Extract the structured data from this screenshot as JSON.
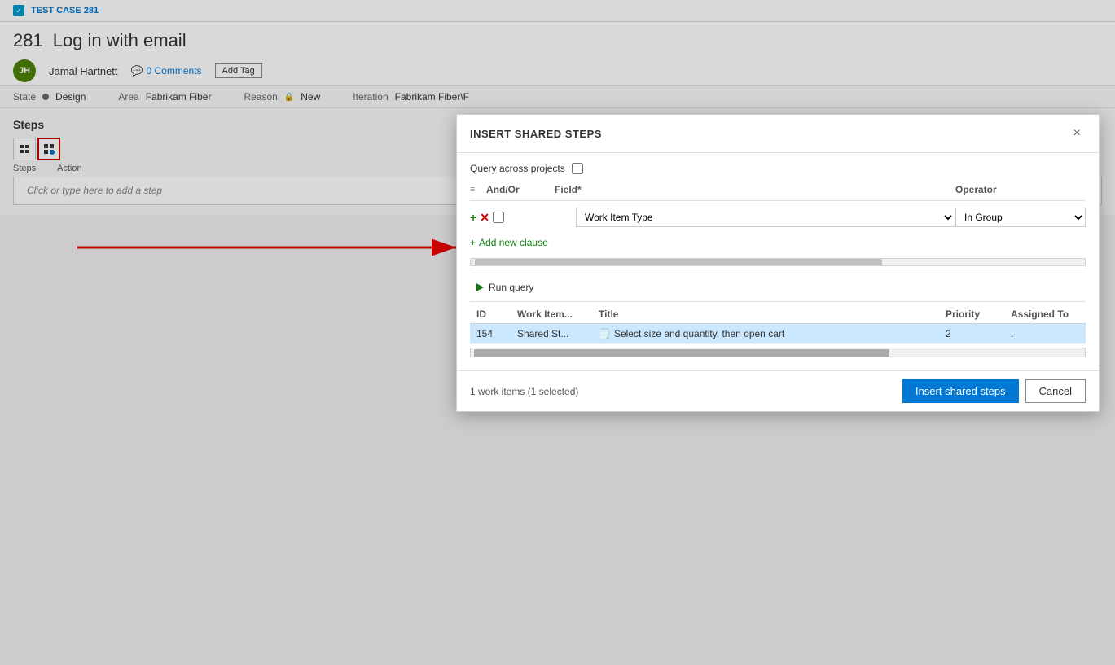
{
  "page": {
    "test_case_label": "TEST CASE 281",
    "work_item_id": "281",
    "work_item_title": "Log in with email",
    "user_initials": "JH",
    "user_name": "Jamal Hartnett",
    "comments": "0 Comments",
    "add_tag": "Add Tag",
    "state_label": "State",
    "state_value": "Design",
    "area_label": "Area",
    "area_value": "Fabrikam Fiber",
    "reason_label": "Reason",
    "reason_value": "New",
    "iteration_label": "Iteration",
    "iteration_value": "Fabrikam Fiber\\F",
    "steps_title": "Steps",
    "steps_placeholder": "Click or type here to add a step",
    "action_label": "Action"
  },
  "modal": {
    "title": "INSERT SHARED STEPS",
    "close_label": "×",
    "query_across_label": "Query across projects",
    "table_header": {
      "andor": "And/Or",
      "field": "Field*",
      "operator": "Operator"
    },
    "clause": {
      "field_value": "Work Item Type",
      "operator_value": "In Group"
    },
    "add_clause_label": "Add new clause",
    "run_query_label": "Run query",
    "results": {
      "col_id": "ID",
      "col_type": "Work Item...",
      "col_title": "Title",
      "col_priority": "Priority",
      "col_assigned": "Assigned To",
      "rows": [
        {
          "id": "154",
          "type": "Shared St...",
          "title": "Select size and quantity, then open cart",
          "priority": "2",
          "assigned": "."
        }
      ]
    },
    "footer_status": "1 work items (1 selected)",
    "insert_btn": "Insert shared steps",
    "cancel_btn": "Cancel"
  }
}
